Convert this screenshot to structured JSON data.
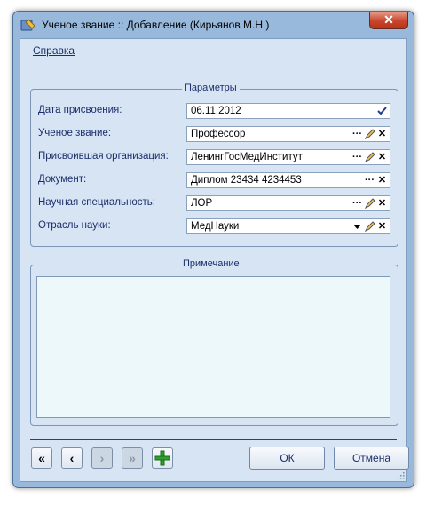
{
  "window": {
    "title": "Ученое звание :: Добавление  (Кирьянов М.Н.)",
    "close_label": "✕"
  },
  "menu": {
    "help_label": "Справка"
  },
  "params": {
    "legend": "Параметры",
    "rows": [
      {
        "label": "Дата присвоения:",
        "value": "06.11.2012"
      },
      {
        "label": "Ученое звание:",
        "value": "Профессор"
      },
      {
        "label": "Присвоившая организация:",
        "value": "ЛенингГосМедИнститут"
      },
      {
        "label": "Документ:",
        "value": "Диплом 23434 4234453"
      },
      {
        "label": "Научная специальность:",
        "value": "ЛОР"
      },
      {
        "label": "Отрасль науки:",
        "value": "МедНауки"
      }
    ]
  },
  "notes": {
    "legend": "Примечание",
    "value": ""
  },
  "buttons": {
    "ok_label": "ОК",
    "cancel_label": "Отмена",
    "first": "«",
    "prev": "‹",
    "next": "›",
    "last": "»"
  },
  "colors": {
    "accent": "#1b3fa3",
    "add_green": "#2fa12f",
    "close_red": "#c9462c"
  }
}
